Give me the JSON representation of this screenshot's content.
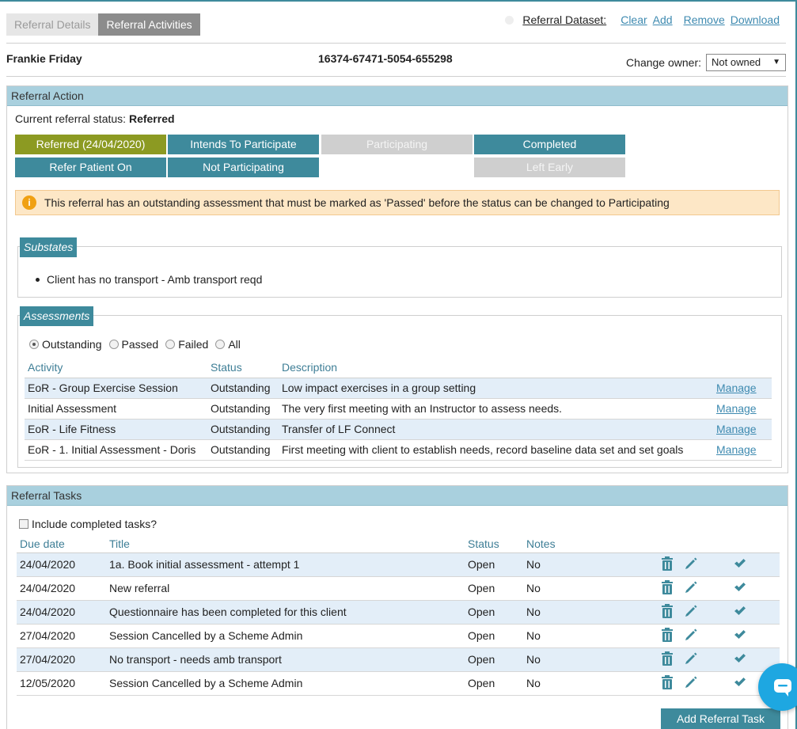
{
  "tabs": [
    {
      "label": "Referral Details",
      "active": false
    },
    {
      "label": "Referral Activities",
      "active": true
    }
  ],
  "dataset": {
    "label": "Referral Dataset:",
    "links": [
      "Clear",
      "Add",
      "Remove",
      "Download"
    ]
  },
  "client": {
    "name": "Frankie Friday",
    "reference": "16374-67471-5054-655298"
  },
  "owner": {
    "label": "Change owner:",
    "selected": "Not owned"
  },
  "referral_action": {
    "title": "Referral Action",
    "status_label": "Current referral status:",
    "status_value": "Referred",
    "buttons": [
      {
        "label": "Referred (24/04/2020)",
        "style": "olive"
      },
      {
        "label": "Intends To Participate",
        "style": "teal"
      },
      {
        "label": "Participating",
        "style": "disabled"
      },
      {
        "label": "Completed",
        "style": "teal"
      },
      {
        "label": "Refer Patient On",
        "style": "teal"
      },
      {
        "label": "Not Participating",
        "style": "teal"
      },
      {
        "label": "Left Early",
        "style": "disabled"
      }
    ],
    "warning": "This referral has an outstanding assessment that must be marked as 'Passed' before the status can be changed to Participating"
  },
  "substates": {
    "title": "Substates",
    "items": [
      "Client has no transport - Amb transport reqd"
    ]
  },
  "assessments": {
    "title": "Assessments",
    "filters": [
      {
        "label": "Outstanding",
        "checked": true
      },
      {
        "label": "Passed",
        "checked": false
      },
      {
        "label": "Failed",
        "checked": false
      },
      {
        "label": "All",
        "checked": false
      }
    ],
    "columns": [
      "Activity",
      "Status",
      "Description"
    ],
    "rows": [
      {
        "activity": "EoR - Group Exercise Session",
        "status": "Outstanding",
        "description": "Low impact exercises in a group setting",
        "action": "Manage"
      },
      {
        "activity": "Initial Assessment",
        "status": "Outstanding",
        "description": "The very first meeting with an Instructor to assess needs.",
        "action": "Manage"
      },
      {
        "activity": "EoR - Life Fitness",
        "status": "Outstanding",
        "description": "Transfer of LF Connect",
        "action": "Manage"
      },
      {
        "activity": "EoR - 1. Initial Assessment - Doris",
        "status": "Outstanding",
        "description": "First meeting with client to establish needs, record baseline data set and set goals",
        "action": "Manage"
      }
    ]
  },
  "tasks": {
    "title": "Referral Tasks",
    "include_completed_label": "Include completed tasks?",
    "columns": [
      "Due date",
      "Title",
      "Status",
      "Notes"
    ],
    "rows": [
      {
        "due": "24/04/2020",
        "title": "1a. Book initial assessment - attempt 1",
        "status": "Open",
        "notes": "No"
      },
      {
        "due": "24/04/2020",
        "title": "New referral",
        "status": "Open",
        "notes": "No"
      },
      {
        "due": "24/04/2020",
        "title": "Questionnaire has been completed for this client",
        "status": "Open",
        "notes": "No"
      },
      {
        "due": "27/04/2020",
        "title": "Session Cancelled by a Scheme Admin",
        "status": "Open",
        "notes": "No"
      },
      {
        "due": "27/04/2020",
        "title": "No transport - needs amb transport",
        "status": "Open",
        "notes": "No"
      },
      {
        "due": "12/05/2020",
        "title": "Session Cancelled by a Scheme Admin",
        "status": "Open",
        "notes": "No"
      }
    ],
    "add_button": "Add Referral Task"
  },
  "colors": {
    "accent_teal": "#3e8a9c",
    "olive": "#8c9a22",
    "panel_header": "#a9d0de",
    "warning_bg": "#fde7c6",
    "chat": "#1ea7e1"
  }
}
